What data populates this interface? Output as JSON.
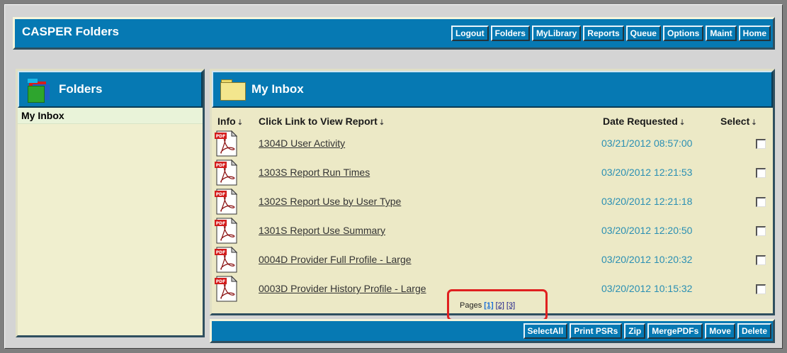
{
  "app": {
    "title": "CASPER Folders"
  },
  "topnav": [
    {
      "label": "Logout",
      "name": "logout-button"
    },
    {
      "label": "Folders",
      "name": "folders-button"
    },
    {
      "label": "MyLibrary",
      "name": "mylibrary-button"
    },
    {
      "label": "Reports",
      "name": "reports-button"
    },
    {
      "label": "Queue",
      "name": "queue-button"
    },
    {
      "label": "Options",
      "name": "options-button"
    },
    {
      "label": "Maint",
      "name": "maint-button"
    },
    {
      "label": "Home",
      "name": "home-button"
    }
  ],
  "left_panel": {
    "title": "Folders",
    "icon": "folders-icon",
    "items": [
      {
        "label": "My Inbox"
      }
    ]
  },
  "main_panel": {
    "title": "My Inbox",
    "icon": "folder-icon",
    "columns": {
      "info": "Info",
      "report": "Click Link to View Report",
      "date": "Date Requested",
      "select": "Select"
    },
    "rows": [
      {
        "report": "1304D User Activity",
        "date": "03/21/2012 08:57:00",
        "icon": "pdf-icon",
        "selected": false
      },
      {
        "report": "1303S Report Run Times",
        "date": "03/20/2012 12:21:53",
        "icon": "pdf-icon",
        "selected": false
      },
      {
        "report": "1302S Report Use by User Type",
        "date": "03/20/2012 12:21:18",
        "icon": "pdf-icon",
        "selected": false
      },
      {
        "report": "1301S Report Use Summary",
        "date": "03/20/2012 12:20:50",
        "icon": "pdf-icon",
        "selected": false
      },
      {
        "report": "0004D Provider Full Profile - Large",
        "date": "03/20/2012 10:20:32",
        "icon": "pdf-icon",
        "selected": false
      },
      {
        "report": "0003D Provider History Profile - Large",
        "date": "03/20/2012 10:15:32",
        "icon": "pdf-icon",
        "selected": false
      }
    ],
    "pagination": {
      "label": "Pages",
      "pages": [
        "[1]",
        "[2]",
        "[3]"
      ],
      "current": "[1]"
    }
  },
  "bottomnav": [
    {
      "label": "SelectAll",
      "name": "selectall-button"
    },
    {
      "label": "Print PSRs",
      "name": "print-psrs-button"
    },
    {
      "label": "Zip",
      "name": "zip-button"
    },
    {
      "label": "MergePDFs",
      "name": "mergepdfs-button"
    },
    {
      "label": "Move",
      "name": "move-button"
    },
    {
      "label": "Delete",
      "name": "delete-button"
    }
  ],
  "colors": {
    "brand_blue": "#0679b3",
    "panel_bg": "#ece9c6",
    "date_text": "#2a8fb3",
    "highlight_red": "#e02020"
  }
}
